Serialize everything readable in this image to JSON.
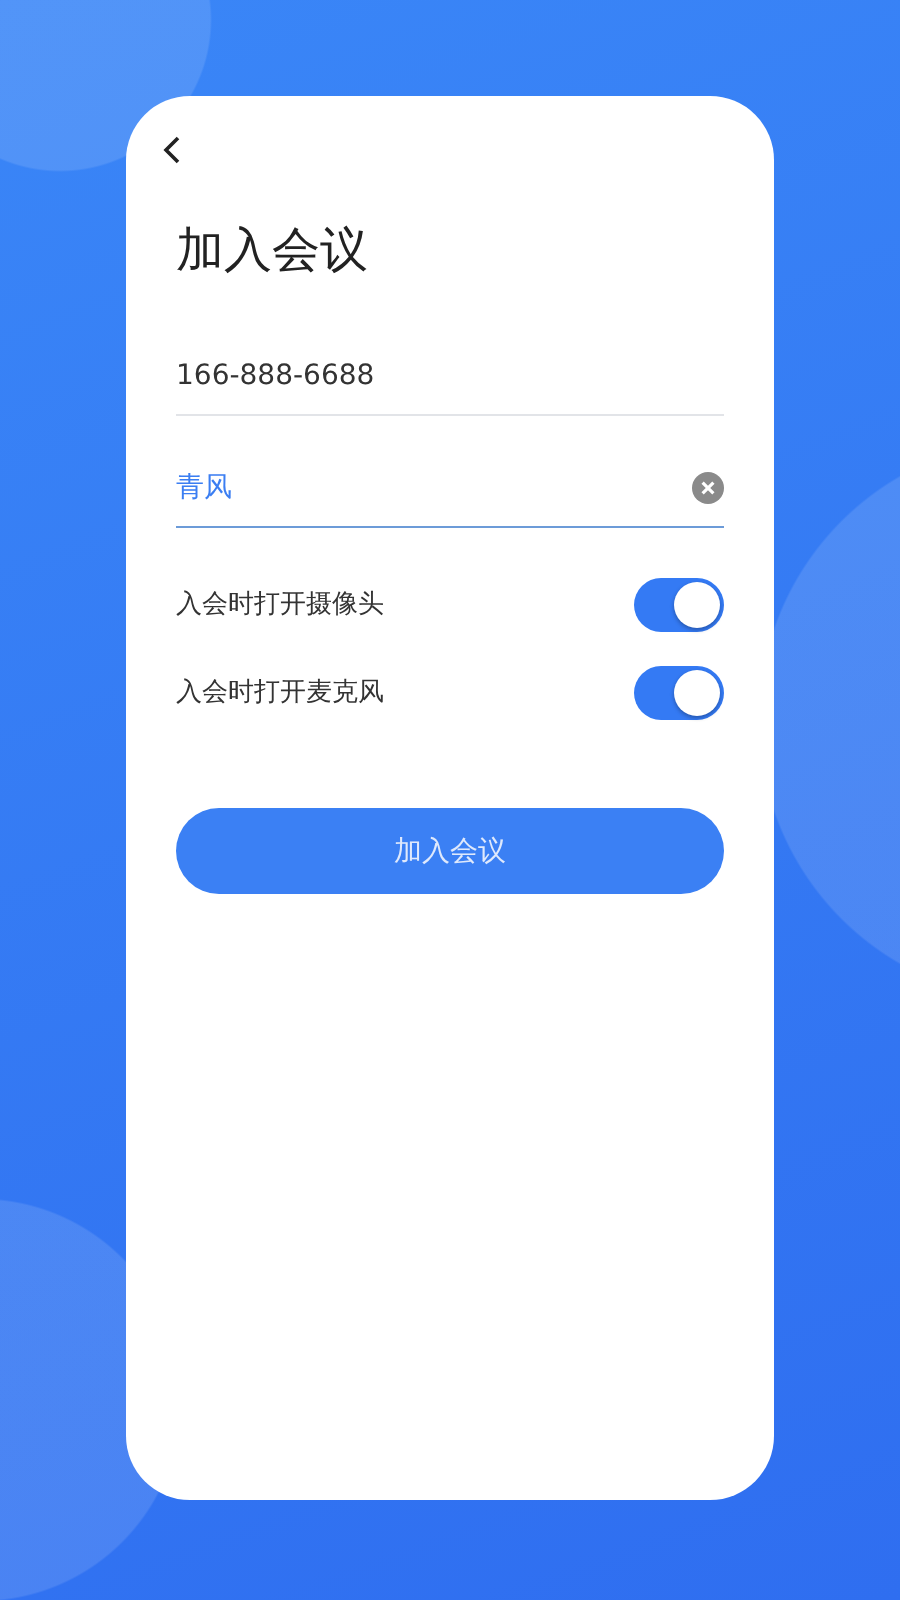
{
  "title": "加入会议",
  "fields": [
    {
      "kind": "plain",
      "value": "166-888-6688",
      "focused": false
    },
    {
      "kind": "clearable",
      "value": "青风",
      "focused": true
    }
  ],
  "toggles": [
    {
      "label": "入会时打开摄像头",
      "on": true
    },
    {
      "label": "入会时打开麦克风",
      "on": true
    }
  ],
  "join_button": "加入会议"
}
